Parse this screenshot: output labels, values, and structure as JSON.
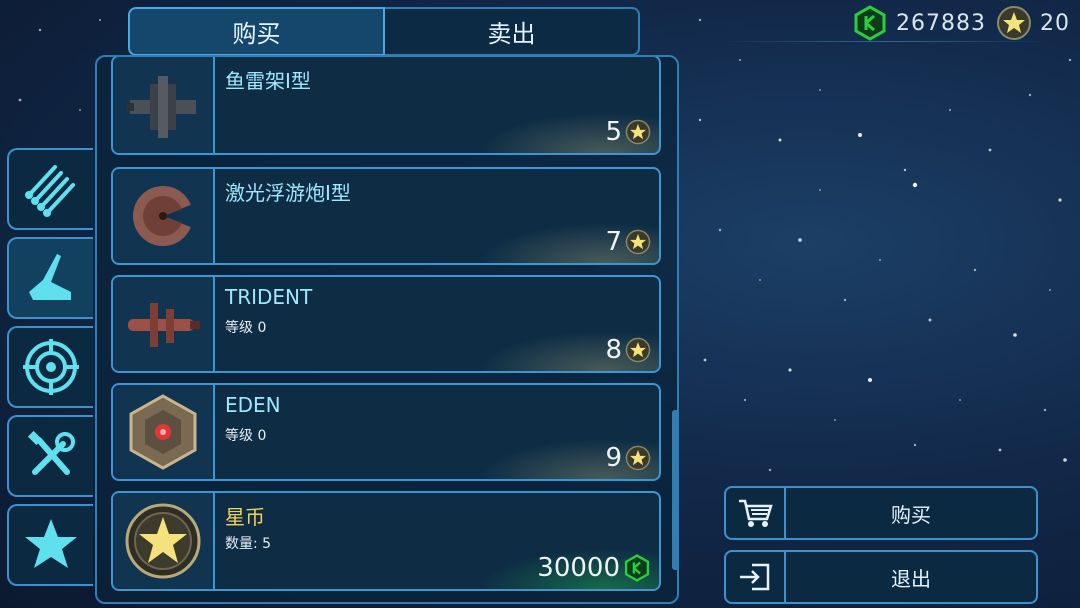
{
  "tabs": [
    {
      "label": "购买",
      "active": true
    },
    {
      "label": "卖出",
      "active": false
    }
  ],
  "currency": {
    "credits": "267883",
    "credits_icon": "green-hex-credit-icon",
    "stars": "20",
    "stars_icon": "gold-star-coin-icon"
  },
  "categories": [
    {
      "name": "missiles",
      "icon": "missile-bundle-icon"
    },
    {
      "name": "hulls",
      "icon": "ship-hull-icon"
    },
    {
      "name": "weapons",
      "icon": "crosshair-icon"
    },
    {
      "name": "modules",
      "icon": "wrench-screwdriver-icon"
    },
    {
      "name": "special",
      "icon": "star-icon"
    }
  ],
  "items": [
    {
      "name": "鱼雷架I型",
      "sub": "",
      "price": "5",
      "currency": "star"
    },
    {
      "name": "激光浮游炮I型",
      "sub": "",
      "price": "7",
      "currency": "star"
    },
    {
      "name": "TRIDENT",
      "sub": "等级 0",
      "price": "8",
      "currency": "star"
    },
    {
      "name": "EDEN",
      "sub": "等级 0",
      "price": "9",
      "currency": "star"
    },
    {
      "name": "星币",
      "sub": "数量: 5",
      "price": "30000",
      "currency": "credit"
    }
  ],
  "actions": {
    "buy_label": "购买",
    "exit_label": "退出"
  },
  "colors": {
    "accent": "#3b97d4",
    "credit_green": "#27d13c",
    "star_gold": "#f2d25b"
  }
}
